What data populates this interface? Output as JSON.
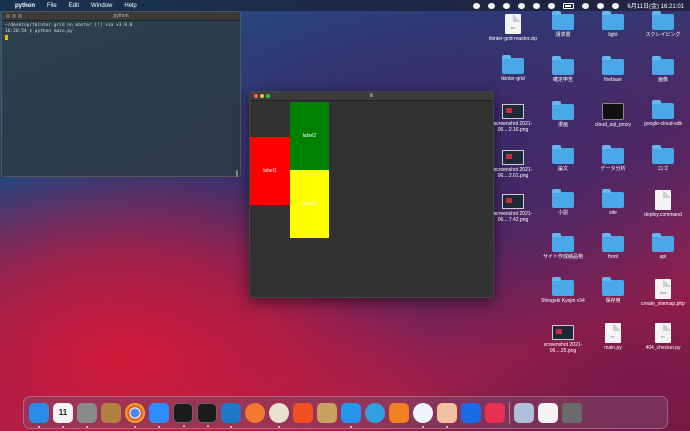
{
  "menubar": {
    "app": "python",
    "menus": [
      "File",
      "Edit",
      "Window",
      "Help"
    ],
    "clock": "6月11日(金)  16:21:01"
  },
  "terminal": {
    "title": "python",
    "line1": "~/desktop/tkinter-grid on  master [!] via  v3.9.0",
    "line2": "16:20:54 ❯ python main.py"
  },
  "tk": {
    "title": "tk",
    "label1": "label1",
    "label2": "label2",
    "label3": "label3",
    "colors": {
      "label1": "#ff0000",
      "label2": "#008000",
      "label3": "#ffff00"
    }
  },
  "desktop": {
    "col1": [
      "tkinter-grid-master.zip",
      "tkinter-grid",
      "screenshot 2021-06....2.16.png",
      "screenshot 2021-06....2.01.png",
      "screenshot 2021-06....7.42.png"
    ],
    "col2": [
      "請求書",
      "確定申告",
      "漫画",
      "論文",
      "小説",
      "サイト作成納品物",
      "Shingeki Kyojin v34",
      "screenshot 2021-06....25.png"
    ],
    "col3": [
      "light",
      "firebase",
      "cloud_sql_proxy",
      "データ分析",
      "site",
      "front",
      "保存用",
      "main.py"
    ],
    "col4": [
      "スクレイピング",
      "画像",
      "google-cloud-sdk",
      "ロゴ",
      "deploy.command",
      "api",
      "create_sitemap.php",
      "404_checker.py"
    ]
  },
  "dock": {
    "calendar_day": "11"
  }
}
